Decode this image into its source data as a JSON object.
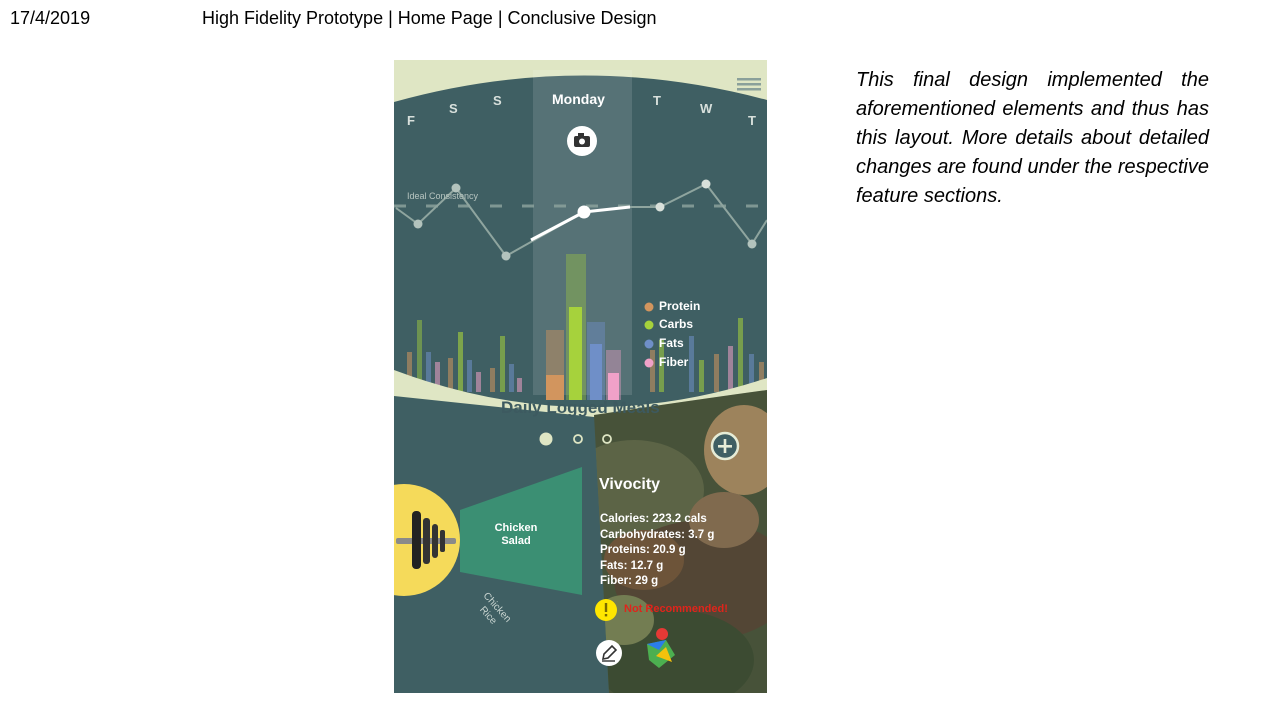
{
  "header": {
    "date": "17/4/2019",
    "title": "High Fidelity Prototype | Home Page | Conclusive Design"
  },
  "description": "This final design implemented the aforementioned elements and thus has this layout. More details about detailed changes are found under the respective feature sections.",
  "app": {
    "days": {
      "left": [
        "F",
        "S",
        "S"
      ],
      "current": "Monday",
      "right": [
        "T",
        "W",
        "T"
      ]
    },
    "chart_label": "Ideal Consistency",
    "legend": [
      {
        "label": "Protein",
        "color": "#d2955e"
      },
      {
        "label": "Carbs",
        "color": "#a6d23c"
      },
      {
        "label": "Fats",
        "color": "#6f8fc8"
      },
      {
        "label": "Fiber",
        "color": "#f0a1c8"
      }
    ],
    "section_title": "Daily Logged Meals",
    "meals": {
      "selected": "Chicken Salad",
      "other": "Chicken Rice"
    },
    "place": "Vivocity",
    "nutrition": [
      "Calories: 223.2 cals",
      "Carbohydrates: 3.7 g",
      "Proteins: 20.9 g",
      "Fats: 12.7 g",
      "Fiber: 29 g"
    ],
    "warning": "Not Recommended!",
    "icons": {
      "menu": "hamburger-menu-icon",
      "camera": "camera-icon",
      "add": "plus-circle-icon",
      "utensils": "fork-icon",
      "edit": "pencil-icon",
      "map": "map-pin-icon",
      "warning": "exclamation-icon"
    },
    "colors": {
      "teal": "#3f5f63",
      "cream": "#dfe6c4",
      "accent_green": "#3b8f73",
      "plate_yellow": "#f5da5a",
      "warning_red": "#e0241b"
    }
  }
}
